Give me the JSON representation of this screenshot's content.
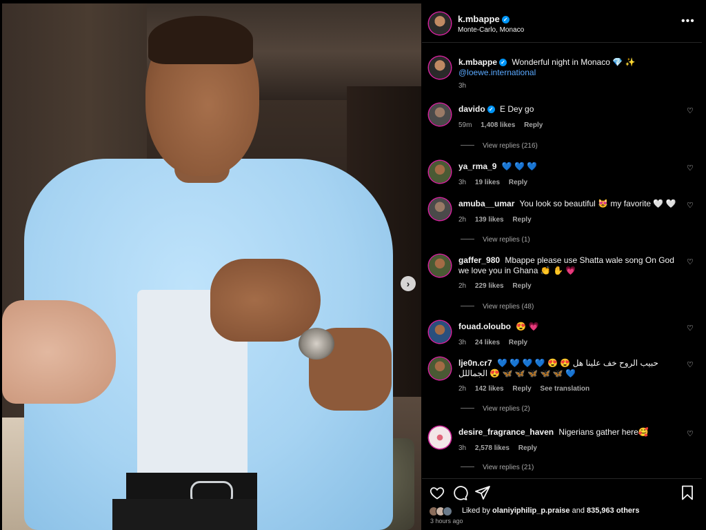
{
  "post": {
    "author": "k.mbappe",
    "location": "Monte-Carlo, Monaco",
    "caption": "Wonderful night in Monaco 💎 ✨",
    "caption_mention": "@loewe.international",
    "caption_age": "3h"
  },
  "comments": [
    {
      "user": "davido",
      "verified": true,
      "text": "E Dey go",
      "age": "59m",
      "likes": "1,408 likes",
      "reply": "Reply",
      "replies": "View replies (216)"
    },
    {
      "user": "ya_rma_9",
      "verified": false,
      "text": "💙 💙 💙",
      "age": "3h",
      "likes": "19 likes",
      "reply": "Reply",
      "replies": ""
    },
    {
      "user": "amuba__umar",
      "verified": false,
      "text": "You look so beautiful 😻 my favorite 🤍 🤍",
      "age": "2h",
      "likes": "139 likes",
      "reply": "Reply",
      "replies": "View replies (1)"
    },
    {
      "user": "gaffer_980",
      "verified": false,
      "text": "Mbappe please use Shatta wale song On God we love you in Ghana 👏 ✋ 💗",
      "age": "2h",
      "likes": "229 likes",
      "reply": "Reply",
      "replies": "View replies (48)"
    },
    {
      "user": "fouad.oloubo",
      "verified": false,
      "text": "😍 💗",
      "age": "3h",
      "likes": "24 likes",
      "reply": "Reply",
      "replies": ""
    },
    {
      "user": "lje0n.cr7",
      "verified": false,
      "text": "💙 💙 💙 💙 😍 😍 حبيب الروح خف علينا هل الجماللل 😍 🦋 🦋 🦋 🦋 🦋 💙",
      "age": "2h",
      "likes": "142 likes",
      "reply": "Reply",
      "translate": "See translation",
      "replies": "View replies (2)"
    },
    {
      "user": "desire_fragrance_haven",
      "verified": false,
      "text": "Nigerians gather here🥰",
      "age": "3h",
      "likes": "2,578 likes",
      "reply": "Reply",
      "replies": "View replies (21)"
    }
  ],
  "likes": {
    "liked_by_prefix": "Liked by",
    "liked_by_user": "olaniyiphilip_p.praise",
    "and": "and",
    "others": "835,963 others"
  },
  "timestamp": "3 hours ago",
  "icons": {
    "more": "more-options-icon",
    "like": "heart-icon",
    "comment": "comment-icon",
    "share": "share-icon",
    "save": "bookmark-icon",
    "next": "chevron-right-icon",
    "verified": "verified-badge-icon"
  },
  "colors": {
    "background": "#000000",
    "text": "#f5f5f5",
    "muted": "#a8a8a8",
    "verified": "#0095f6",
    "mention": "#5aa9ff"
  }
}
